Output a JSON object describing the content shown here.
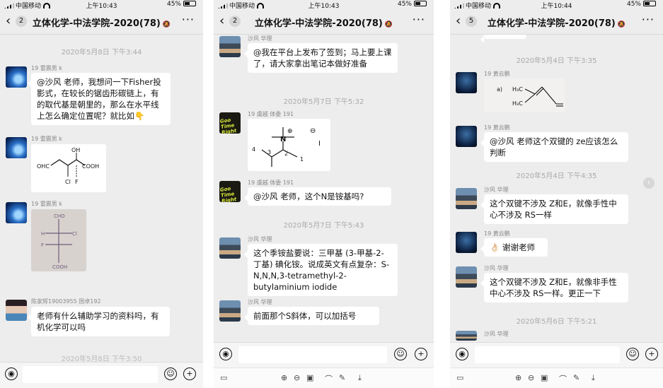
{
  "status": {
    "carrier": "中国移动",
    "battery": "45%",
    "times": [
      "上午10:43",
      "上午10:43",
      "上午10:44"
    ]
  },
  "chat_title": "立体化学-中法学院-2020(78)",
  "badges": [
    "2",
    "2",
    "5"
  ],
  "screen1": {
    "partial_top": "...",
    "ts1": "2020年5月8日 下午3:44",
    "m1_name": "19 雷震男 k",
    "m1_text": "@沙风 老师，我想问一下Fisher投影式，在较长的锯齿形碳链上，有的取代基是朝里的，那么在水平线上怎么确定位置呢？就比如👇",
    "m2_name": "19 雷震男 k",
    "m3_name": "19 雷震男 k",
    "m4_name": "陈家辉19003955 国卓192",
    "m4_text": "老师有什么辅助学习的资料吗，有机化学可以吗",
    "ts2": "2020年5月8日 下午3:50",
    "struct_labels": {
      "oh": "OH",
      "ohc": "OHC",
      "cooh": "COOH",
      "cl": "Cl",
      "f": "F"
    },
    "hand_labels": {
      "cho": "CHO",
      "h": "H",
      "cl": "Cl",
      "f": "F",
      "cooh": "COOH"
    }
  },
  "screen2": {
    "m0_name": "沙风 华理",
    "m0_text": "@我在平台上发布了签到；马上要上课了，请大家拿出笔记本做好准备",
    "ts1": "2020年5月7日 下午5:32",
    "m1_name": "19 虞越 体委 191",
    "m2_name": "19 虞越 体委 191",
    "m2_text": "@沙风 老师，这个N是铵基吗?",
    "ts2": "2020年5月7日 下午5:43",
    "m3_name": "沙风 华理",
    "m3_text": "这个季铵盐要说：三甲基 (3-甲基-2-丁基) 碘化铵。说成英文有点复杂：S-N,N,N,3-tetramethyl-2-butylaminium iodide",
    "m4_name": "沙风 华理",
    "m4_text": "前面那个S斜体，可以加括号",
    "logo_text": "Goo Time Right",
    "struct_labels": {
      "n": "N",
      "plus": "⊕",
      "minus": "⊖",
      "i": "I",
      "c1": "1",
      "c2": "2",
      "c3": "3",
      "c4": "4"
    }
  },
  "screen3": {
    "ts1": "2020年5月4日 下午3:35",
    "m1_name": "19 黄云鹏",
    "m2_name": "19 黄云鹏",
    "m2_text": "@沙风 老师这个双键的 ze应该怎么判断",
    "ts2": "2020年5月4日 下午4:35",
    "m3_name": "沙风 华理",
    "m3_text": "这个双键不涉及 Z和E，就像手性中心不涉及 RS一样",
    "m4_name": "19 黄云鹏",
    "m4_text": "👌🏻 谢谢老师",
    "m5_name": "沙风 华理",
    "m5_text": "这个双键不涉及 Z和E，就像非手性中心不涉及 RS一样。更正一下",
    "ts3": "2020年5月6日 下午5:21",
    "m6_name": "沙风 华理",
    "struct_labels": {
      "a": "a)",
      "h3c_top": "H₃C",
      "h3c_bot": "H₃C"
    }
  },
  "icons": {
    "voice": "voice-icon",
    "emoji": "emoji-icon",
    "plus": "plus-icon"
  }
}
